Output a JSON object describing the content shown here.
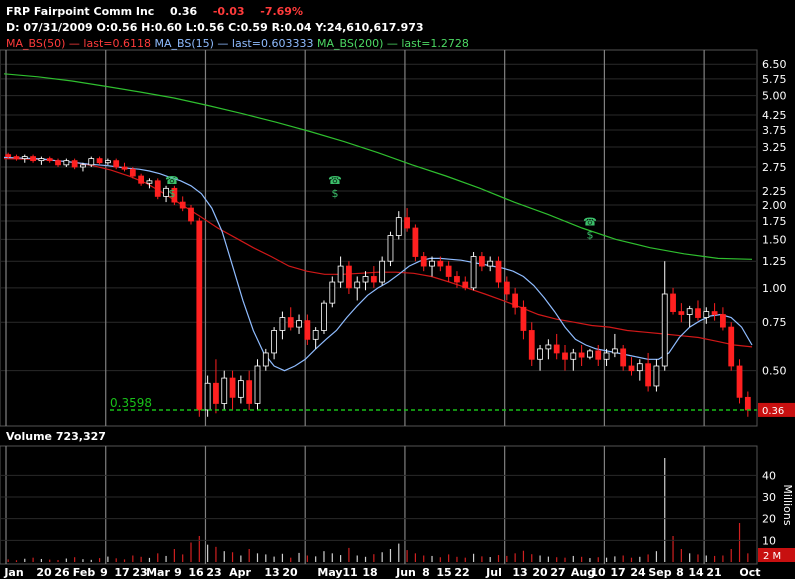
{
  "header": {
    "symbol": "FRP",
    "company": "Fairpoint Comm Inc",
    "last": "0.36",
    "change": "-0.03",
    "change_pct": "-7.69%",
    "date_line": "D: 07/31/2009 O:0.56 H:0.60 L:0.56 C:0.59 R:0.04 Y:24,610,617.973",
    "ma50": "MA_BS(50) — last=0.6118",
    "ma15": "MA_BS(15) — last=0.603333",
    "ma200": "MA_BS(200) — last=1.2728"
  },
  "volume": {
    "title": "Volume 723,327",
    "units_label": "Millions"
  },
  "support_label": "0.3598",
  "last_price_label": "0.36",
  "colors": {
    "up": "#ffffff",
    "down": "#ff2020",
    "ma15": "#8fbcff",
    "ma50": "#d01818",
    "ma200": "#2fbf2f",
    "support": "#19c019",
    "grid": "#2a2a2a",
    "vgrid": "#808080"
  },
  "chart_data": {
    "type": "candlestick",
    "title": "FRP Fairpoint Comm Inc",
    "y_scale": "log",
    "y_ticks": [
      0.5,
      0.75,
      1.0,
      1.25,
      1.5,
      1.75,
      2.0,
      2.25,
      2.75,
      3.25,
      3.75,
      4.25,
      5.0,
      5.75,
      6.5
    ],
    "y_tick_labels": [
      "0.50",
      "0.75",
      "1.00",
      "1.25",
      "1.50",
      "1.75",
      "2.00",
      "2.25",
      "2.75",
      "3.25",
      "3.75",
      "4.25",
      "5.00",
      "5.75",
      "6.50"
    ],
    "x_labels": [
      "Jan",
      "20",
      "26",
      "Feb",
      "9",
      "17",
      "23",
      "Mar",
      "9",
      "16",
      "23",
      "Apr",
      "13",
      "20",
      "May",
      "11",
      "18",
      "Jun",
      "8",
      "15",
      "22",
      "Jul",
      "13",
      "20",
      "27",
      "Aug",
      "10",
      "17",
      "24",
      "Sep",
      "8",
      "14",
      "21",
      "Oct"
    ],
    "support_level": 0.3598,
    "last_price": 0.36,
    "candles": [
      [
        3.05,
        3.1,
        2.95,
        3.0
      ],
      [
        3.0,
        3.05,
        2.9,
        2.95
      ],
      [
        2.95,
        3.05,
        2.85,
        3.0
      ],
      [
        3.0,
        3.05,
        2.85,
        2.9
      ],
      [
        2.9,
        3.0,
        2.8,
        2.95
      ],
      [
        2.95,
        3.0,
        2.85,
        2.9
      ],
      [
        2.9,
        2.95,
        2.75,
        2.8
      ],
      [
        2.8,
        2.95,
        2.75,
        2.9
      ],
      [
        2.9,
        2.95,
        2.7,
        2.75
      ],
      [
        2.75,
        2.85,
        2.65,
        2.8
      ],
      [
        2.8,
        3.0,
        2.75,
        2.95
      ],
      [
        2.95,
        3.0,
        2.8,
        2.85
      ],
      [
        2.85,
        2.95,
        2.8,
        2.9
      ],
      [
        2.9,
        2.95,
        2.7,
        2.75
      ],
      [
        2.75,
        2.85,
        2.65,
        2.7
      ],
      [
        2.7,
        2.75,
        2.5,
        2.55
      ],
      [
        2.55,
        2.6,
        2.35,
        2.4
      ],
      [
        2.4,
        2.5,
        2.3,
        2.45
      ],
      [
        2.45,
        2.5,
        2.1,
        2.15
      ],
      [
        2.15,
        2.35,
        2.05,
        2.3
      ],
      [
        2.3,
        2.35,
        2.0,
        2.05
      ],
      [
        2.05,
        2.15,
        1.9,
        1.95
      ],
      [
        1.95,
        2.0,
        1.7,
        1.75
      ],
      [
        1.75,
        1.8,
        0.34,
        0.36
      ],
      [
        0.36,
        0.48,
        0.34,
        0.45
      ],
      [
        0.45,
        0.55,
        0.35,
        0.38
      ],
      [
        0.38,
        0.5,
        0.36,
        0.47
      ],
      [
        0.47,
        0.5,
        0.36,
        0.4
      ],
      [
        0.4,
        0.48,
        0.38,
        0.46
      ],
      [
        0.46,
        0.5,
        0.36,
        0.38
      ],
      [
        0.38,
        0.55,
        0.36,
        0.52
      ],
      [
        0.52,
        0.6,
        0.5,
        0.58
      ],
      [
        0.58,
        0.72,
        0.55,
        0.7
      ],
      [
        0.7,
        0.82,
        0.65,
        0.78
      ],
      [
        0.78,
        0.85,
        0.7,
        0.72
      ],
      [
        0.72,
        0.8,
        0.68,
        0.76
      ],
      [
        0.76,
        0.8,
        0.62,
        0.65
      ],
      [
        0.65,
        0.72,
        0.6,
        0.7
      ],
      [
        0.7,
        0.9,
        0.68,
        0.88
      ],
      [
        0.88,
        1.1,
        0.85,
        1.05
      ],
      [
        1.05,
        1.3,
        1.0,
        1.2
      ],
      [
        1.2,
        1.25,
        0.95,
        1.0
      ],
      [
        1.0,
        1.1,
        0.9,
        1.05
      ],
      [
        1.05,
        1.15,
        0.98,
        1.1
      ],
      [
        1.1,
        1.2,
        1.0,
        1.05
      ],
      [
        1.05,
        1.3,
        1.02,
        1.25
      ],
      [
        1.25,
        1.6,
        1.2,
        1.55
      ],
      [
        1.55,
        1.9,
        1.5,
        1.8
      ],
      [
        1.8,
        1.95,
        1.6,
        1.65
      ],
      [
        1.65,
        1.7,
        1.25,
        1.3
      ],
      [
        1.3,
        1.35,
        1.15,
        1.2
      ],
      [
        1.2,
        1.3,
        1.1,
        1.25
      ],
      [
        1.25,
        1.3,
        1.15,
        1.2
      ],
      [
        1.2,
        1.25,
        1.05,
        1.1
      ],
      [
        1.1,
        1.15,
        1.0,
        1.05
      ],
      [
        1.05,
        1.1,
        0.98,
        1.0
      ],
      [
        1.0,
        1.35,
        0.98,
        1.3
      ],
      [
        1.3,
        1.35,
        1.15,
        1.2
      ],
      [
        1.2,
        1.3,
        1.15,
        1.25
      ],
      [
        1.25,
        1.3,
        1.0,
        1.05
      ],
      [
        1.05,
        1.1,
        0.9,
        0.95
      ],
      [
        0.95,
        1.0,
        0.8,
        0.85
      ],
      [
        0.85,
        0.9,
        0.65,
        0.7
      ],
      [
        0.7,
        0.75,
        0.52,
        0.55
      ],
      [
        0.55,
        0.62,
        0.5,
        0.6
      ],
      [
        0.6,
        0.65,
        0.55,
        0.62
      ],
      [
        0.62,
        0.68,
        0.55,
        0.58
      ],
      [
        0.58,
        0.62,
        0.5,
        0.55
      ],
      [
        0.55,
        0.6,
        0.5,
        0.58
      ],
      [
        0.58,
        0.62,
        0.52,
        0.56
      ],
      [
        0.56,
        0.6,
        0.55,
        0.59
      ],
      [
        0.59,
        0.62,
        0.52,
        0.55
      ],
      [
        0.55,
        0.6,
        0.52,
        0.58
      ],
      [
        0.58,
        0.68,
        0.56,
        0.6
      ],
      [
        0.6,
        0.62,
        0.5,
        0.52
      ],
      [
        0.52,
        0.56,
        0.48,
        0.5
      ],
      [
        0.5,
        0.55,
        0.46,
        0.53
      ],
      [
        0.53,
        0.58,
        0.42,
        0.44
      ],
      [
        0.44,
        0.55,
        0.42,
        0.52
      ],
      [
        0.52,
        1.25,
        0.5,
        0.95
      ],
      [
        0.95,
        1.0,
        0.8,
        0.82
      ],
      [
        0.82,
        0.88,
        0.75,
        0.8
      ],
      [
        0.8,
        0.86,
        0.72,
        0.84
      ],
      [
        0.84,
        0.9,
        0.76,
        0.78
      ],
      [
        0.78,
        0.85,
        0.74,
        0.82
      ],
      [
        0.82,
        0.88,
        0.76,
        0.8
      ],
      [
        0.8,
        0.85,
        0.7,
        0.72
      ],
      [
        0.72,
        0.75,
        0.5,
        0.52
      ],
      [
        0.52,
        0.55,
        0.38,
        0.4
      ],
      [
        0.4,
        0.42,
        0.34,
        0.36
      ]
    ],
    "ma15": [
      2.98,
      2.97,
      2.96,
      2.95,
      2.93,
      2.9,
      2.88,
      2.85,
      2.82,
      2.8,
      2.78,
      2.75,
      2.72,
      2.7,
      2.66,
      2.6,
      2.52,
      2.45,
      2.35,
      2.2,
      1.95,
      1.6,
      1.2,
      0.9,
      0.7,
      0.58,
      0.52,
      0.5,
      0.52,
      0.55,
      0.6,
      0.65,
      0.7,
      0.78,
      0.86,
      0.94,
      1.0,
      1.05,
      1.12,
      1.2,
      1.25,
      1.28,
      1.28,
      1.27,
      1.26,
      1.24,
      1.22,
      1.2,
      1.18,
      1.15,
      1.1,
      1.02,
      0.92,
      0.82,
      0.72,
      0.65,
      0.62,
      0.6,
      0.59,
      0.58,
      0.57,
      0.56,
      0.55,
      0.55,
      0.58,
      0.66,
      0.72,
      0.76,
      0.79,
      0.8,
      0.78,
      0.72,
      0.62
    ],
    "ma50": [
      2.95,
      2.94,
      2.93,
      2.9,
      2.85,
      2.78,
      2.68,
      2.55,
      2.4,
      2.2,
      2.0,
      1.82,
      1.65,
      1.52,
      1.4,
      1.3,
      1.2,
      1.15,
      1.12,
      1.12,
      1.13,
      1.14,
      1.14,
      1.13,
      1.1,
      1.05,
      1.0,
      0.95,
      0.9,
      0.85,
      0.8,
      0.77,
      0.75,
      0.73,
      0.72,
      0.7,
      0.69,
      0.68,
      0.67,
      0.66,
      0.64,
      0.62,
      0.61
    ],
    "ma200": [
      6.0,
      5.85,
      5.65,
      5.4,
      5.15,
      4.9,
      4.6,
      4.3,
      4.0,
      3.7,
      3.4,
      3.1,
      2.8,
      2.55,
      2.3,
      2.05,
      1.85,
      1.65,
      1.5,
      1.4,
      1.33,
      1.28,
      1.27
    ],
    "volume_millions": [
      1.2,
      0.8,
      1.5,
      2.0,
      1.4,
      1.1,
      0.9,
      1.6,
      2.2,
      1.3,
      1.0,
      1.8,
      2.5,
      1.7,
      1.2,
      3.0,
      2.4,
      1.9,
      4.0,
      2.8,
      6.0,
      3.5,
      9.0,
      12.0,
      8.0,
      7.0,
      5.0,
      4.5,
      3.0,
      6.0,
      4.0,
      3.5,
      2.5,
      3.8,
      2.0,
      4.2,
      3.0,
      2.6,
      5.0,
      4.0,
      3.2,
      6.5,
      3.0,
      2.4,
      3.6,
      4.5,
      6.0,
      8.5,
      5.5,
      4.0,
      3.0,
      2.8,
      2.2,
      3.5,
      2.4,
      2.0,
      3.8,
      2.6,
      2.3,
      3.2,
      2.8,
      4.0,
      5.2,
      3.6,
      3.0,
      2.5,
      2.2,
      2.0,
      2.8,
      2.4,
      1.8,
      2.2,
      2.0,
      2.6,
      3.0,
      2.0,
      2.4,
      3.5,
      5.0,
      48.0,
      12.0,
      6.0,
      4.0,
      3.5,
      3.0,
      2.8,
      3.0,
      6.0,
      18.0,
      4.0
    ],
    "volume_ticks": [
      10,
      20,
      30,
      40
    ],
    "volume_last_label": "2 M"
  }
}
